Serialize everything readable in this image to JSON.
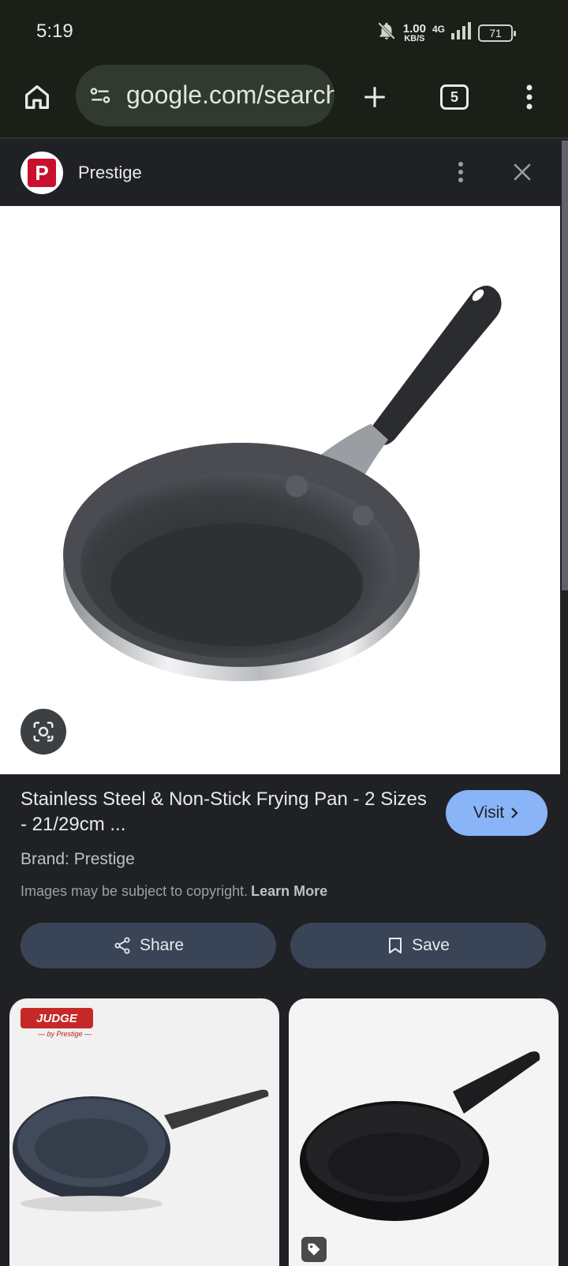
{
  "status_bar": {
    "time": "5:19",
    "net_speed_value": "1.00",
    "net_speed_unit": "KB/S",
    "network_type": "4G",
    "battery_level": "71"
  },
  "toolbar": {
    "url": "google.com/search",
    "tab_count": "5"
  },
  "panel": {
    "source_logo_letter": "P",
    "source_name": "Prestige"
  },
  "details": {
    "title": "Stainless Steel & Non-Stick Frying Pan - 2 Sizes - 21/29cm ...",
    "visit_label": "Visit",
    "brand": "Brand: Prestige",
    "copyright_text": "Images may be subject to copyright.",
    "learn_more_label": "Learn More",
    "share_label": "Share",
    "save_label": "Save"
  },
  "related": {
    "thumb1_logo": "JUDGE",
    "thumb1_logo_sub": "— by Prestige —"
  },
  "colors": {
    "accent": "#8ab4f8",
    "background": "#202124",
    "action_button": "#394457",
    "brand_red": "#c8102e"
  }
}
